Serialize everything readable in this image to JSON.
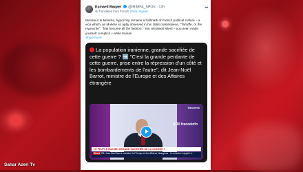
{
  "watermark": "Sahar Azeri Tv",
  "tweet": {
    "author_name": "Esmaeil Baqaei",
    "handle": "@IRIMFA_SPOX",
    "time": "· 12h",
    "translated_prefix": "Translated from French",
    "show_original": "Show original",
    "body": "Monsieur le Ministre, hypocrisy remains a hallmark of French political culture – a vice which, as Molière so aptly observed in his 1664 masterpiece, \"Tartuffe, or the Hypocrite\", \"has become all the fashion.\" You remained silent – you even made yourself complicit – while Iranian",
    "show_more": "Show more"
  },
  "media": {
    "headline": "La population iranienne, grande sacrifiée de cette guerre ? ➡️ \"C'est la grande perdante de cette guerre, prise entre la répression d'un côté et les bombardements de l'autre\", dit Jean-Noël Barrot, ministre de l'Europe et des Affaires étrangère",
    "video": {
      "channel_logo": "franceinfo",
      "clock": "8.30 franceinfo",
      "banner": "LE PEUPLE IRANIEN GRANDE SACRIFIÉE DE LA GUERRE ?",
      "ticker_tag": "Direct",
      "ticker_text": "DB: Jean-Noël Barrot, ministre de l'Europe et des Affaires étrangères · Le ministre a appelé à..."
    }
  },
  "colors": {
    "background": "#b3131c",
    "link": "#1d9bf0",
    "media_bg": "#171717"
  }
}
